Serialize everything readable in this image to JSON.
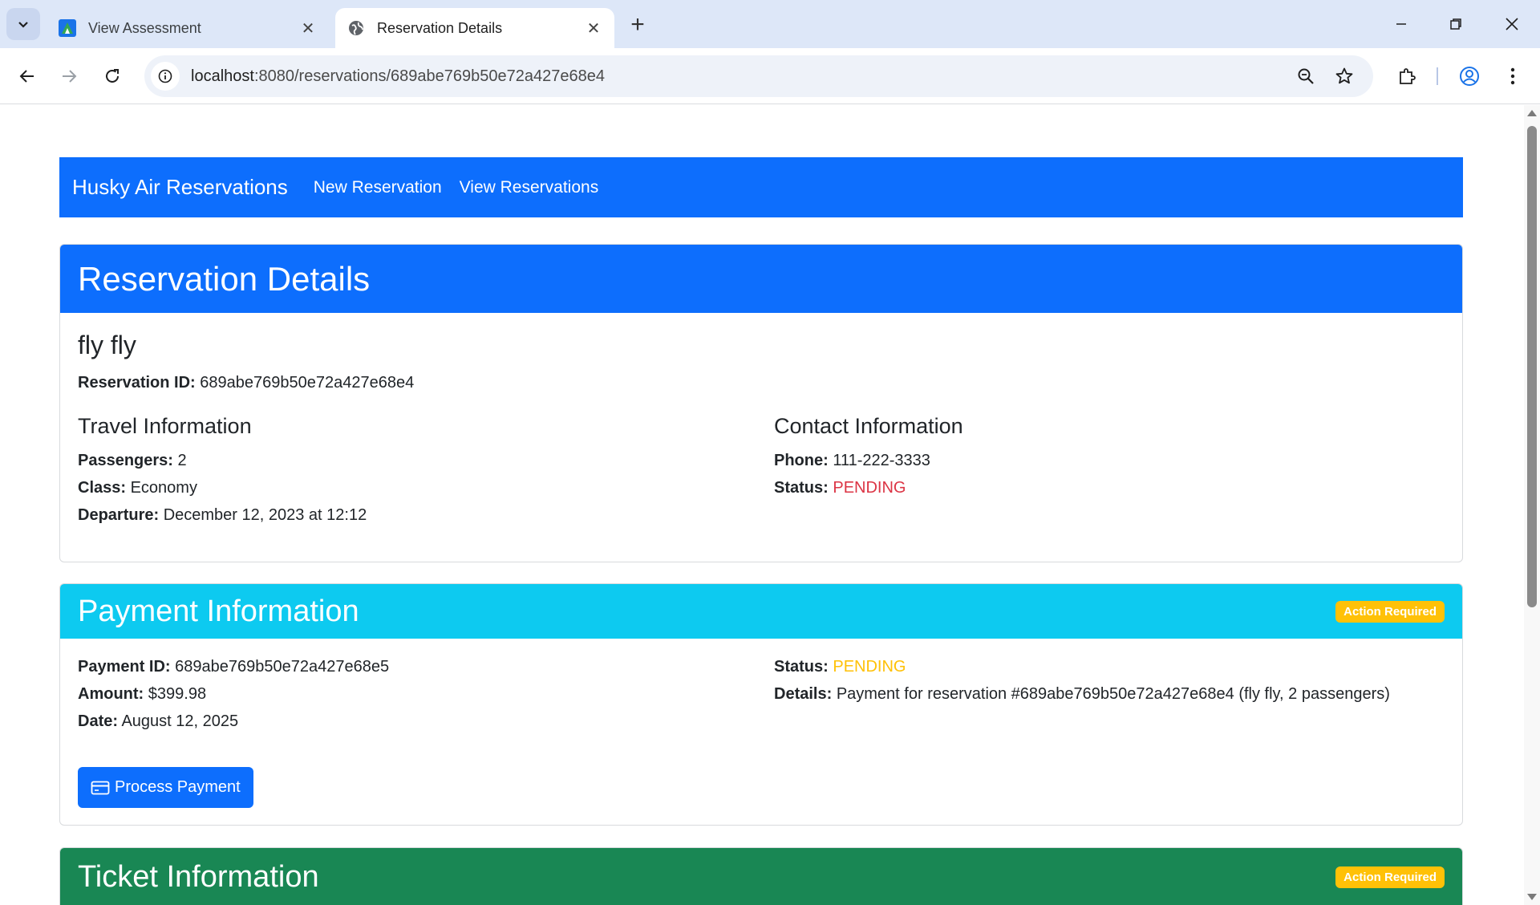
{
  "browser": {
    "tabs": [
      {
        "title": "View Assessment",
        "icon": "app-favicon",
        "active": false
      },
      {
        "title": "Reservation Details",
        "icon": "globe-icon",
        "active": true
      }
    ],
    "url_host": "localhost",
    "url_path": ":8080/reservations/689abe769b50e72a427e68e4"
  },
  "navbar": {
    "brand": "Husky Air Reservations",
    "links": [
      "New Reservation",
      "View Reservations"
    ]
  },
  "reservation": {
    "header": "Reservation Details",
    "name": "fly fly",
    "id_label": "Reservation ID:",
    "id_value": "689abe769b50e72a427e68e4",
    "travel": {
      "heading": "Travel Information",
      "passengers_label": "Passengers:",
      "passengers_value": "2",
      "class_label": "Class:",
      "class_value": "Economy",
      "departure_label": "Departure:",
      "departure_value": "December 12, 2023 at 12:12"
    },
    "contact": {
      "heading": "Contact Information",
      "phone_label": "Phone:",
      "phone_value": "111-222-3333",
      "status_label": "Status:",
      "status_value": "PENDING"
    }
  },
  "payment": {
    "header": "Payment Information",
    "badge": "Action Required",
    "id_label": "Payment ID:",
    "id_value": "689abe769b50e72a427e68e5",
    "amount_label": "Amount:",
    "amount_value": "$399.98",
    "date_label": "Date:",
    "date_value": "August 12, 2025",
    "status_label": "Status:",
    "status_value": "PENDING",
    "details_label": "Details:",
    "details_value": "Payment for reservation #689abe769b50e72a427e68e4 (fly fly, 2 passengers)",
    "button": "Process Payment"
  },
  "ticket": {
    "header": "Ticket Information",
    "badge": "Action Required"
  },
  "colors": {
    "primary": "#0d6efd",
    "info": "#0dcaf0",
    "success": "#198754",
    "warning": "#ffc107",
    "danger": "#dc3545"
  }
}
